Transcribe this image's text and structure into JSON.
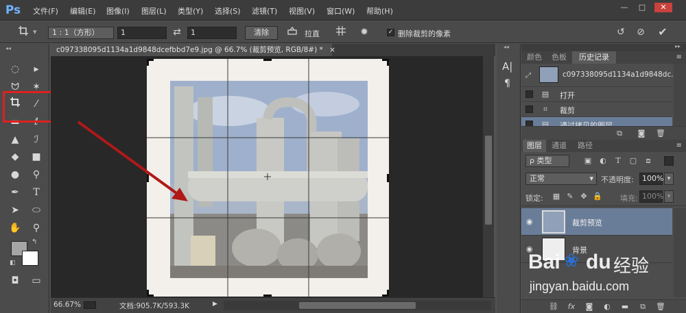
{
  "app": {
    "logo": "Ps"
  },
  "menu": [
    "文件(F)",
    "编辑(E)",
    "图像(I)",
    "图层(L)",
    "类型(Y)",
    "选择(S)",
    "滤镜(T)",
    "视图(V)",
    "窗口(W)",
    "帮助(H)"
  ],
  "window_controls": {
    "minimize": "—",
    "restore": "□",
    "close": "✕"
  },
  "options": {
    "ratio_select": "1 : 1（方形）",
    "width_value": "1",
    "height_value": "1",
    "clear_label": "清除",
    "straighten_label": "拉直",
    "delete_cropped_label": "删除裁剪的像素",
    "delete_cropped_checked": "✓"
  },
  "document": {
    "tab_title": "c097338095d1134a1d9848dcefbbd7e9.jpg @ 66.7% (裁剪预览, RGB/8#) *",
    "tab_close": "×"
  },
  "status": {
    "zoom": "66.67%",
    "doc_info": "文档:905.7K/593.3K",
    "arrow": "▶"
  },
  "mini_dock": {
    "char_icon": "A|",
    "para_icon": "¶"
  },
  "history_panel": {
    "tabs": [
      "颜色",
      "色板",
      "历史记录"
    ],
    "active_tab": "历史记录",
    "snapshot_name": "c097338095d1134a1d9848dc...",
    "items": [
      "打开",
      "裁剪",
      "通过拷贝的图层"
    ]
  },
  "layers_panel": {
    "tabs": [
      "图层",
      "通道",
      "路径"
    ],
    "active_tab": "图层",
    "filter_kind": "ρ 类型",
    "blend_mode": "正常",
    "opacity_label": "不透明度:",
    "opacity_value": "100%",
    "lock_label": "锁定:",
    "fill_label": "填充:",
    "fill_value": "100%",
    "layers": [
      {
        "name": "裁剪预览",
        "selected": true
      },
      {
        "name": "背景",
        "selected": false
      }
    ]
  },
  "watermark": {
    "brand": "Bai",
    "brand2": "du",
    "jingyan": "经验",
    "url": "jingyan.baidu.com"
  },
  "colors": {
    "accent_red": "#e02020",
    "selected_row": "#6a7d98",
    "ps_blue": "#6fb3ff"
  }
}
